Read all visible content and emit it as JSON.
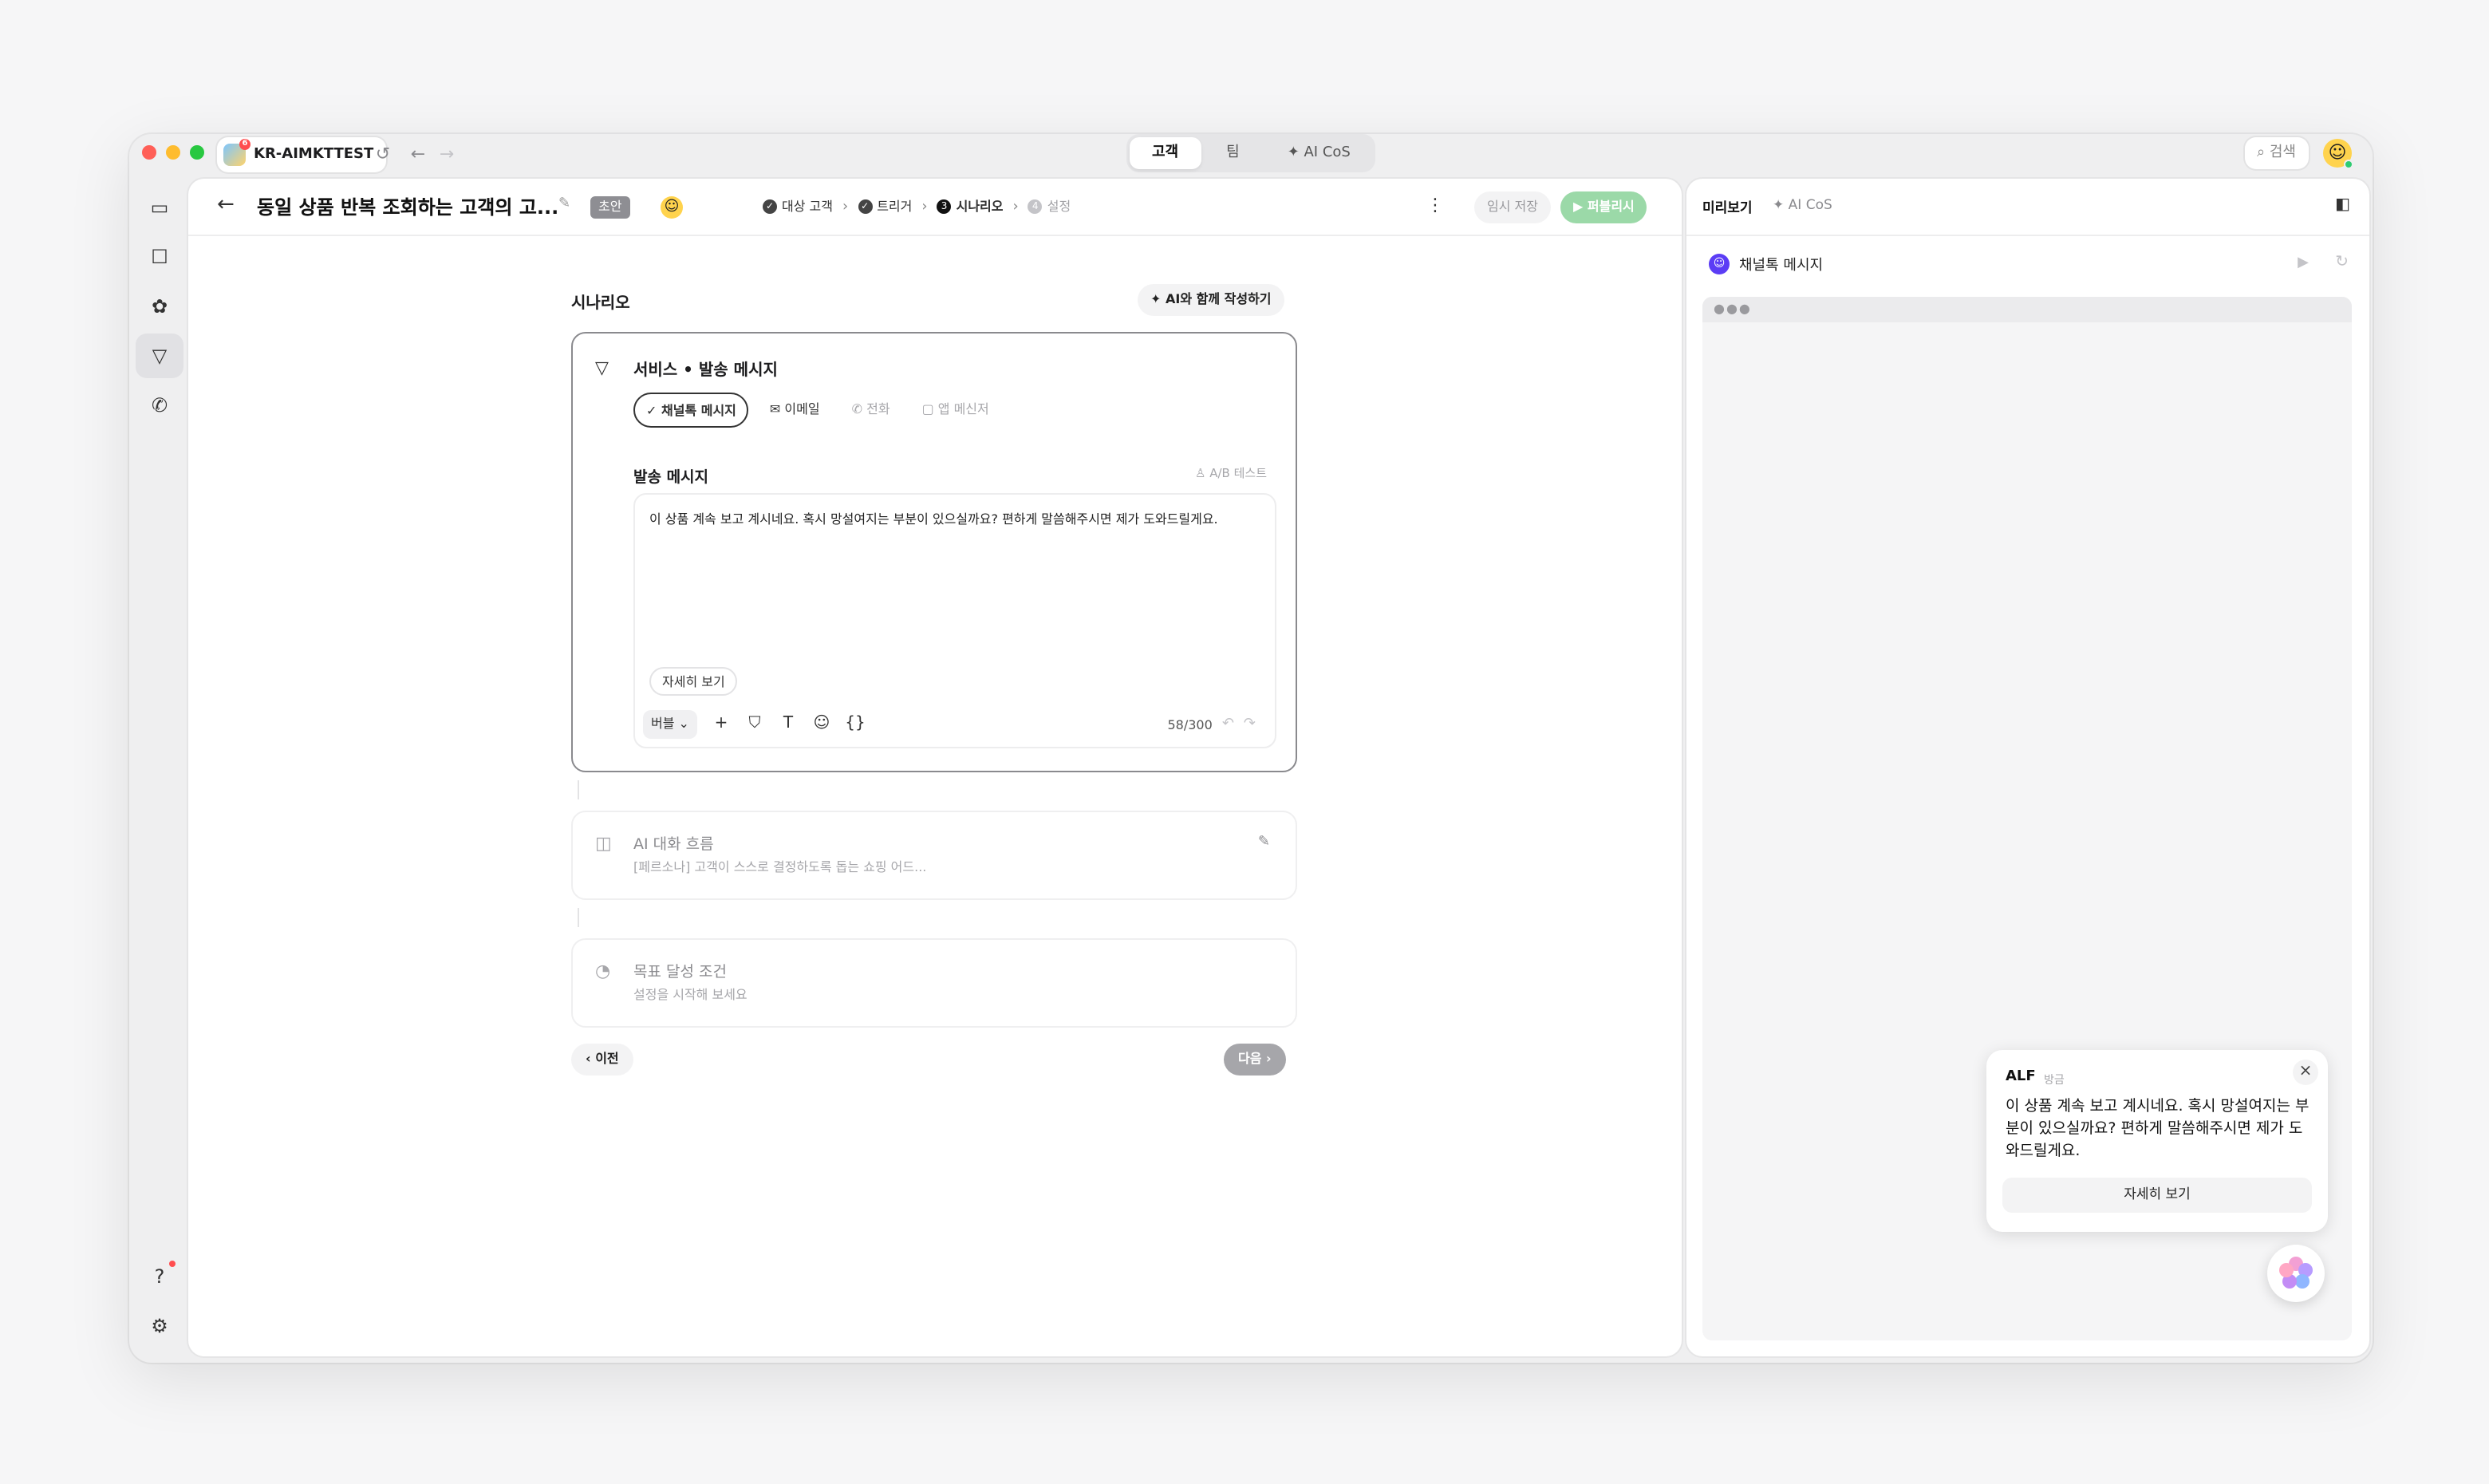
{
  "titlebar": {
    "workspace_name": "KR-AIMKTTEST",
    "workspace_badge": "6",
    "tabs": [
      {
        "label": "고객",
        "active": true
      },
      {
        "label": "팀",
        "active": false
      },
      {
        "label": "✦ AI CoS",
        "active": false
      }
    ],
    "search_label": "검색"
  },
  "header": {
    "title": "동일 상품 반복 조회하는 고객의 고...",
    "status_badge": "초안",
    "steps": [
      {
        "label": "대상 고객",
        "state": "done"
      },
      {
        "label": "트리거",
        "state": "done"
      },
      {
        "label": "시나리오",
        "state": "current",
        "number": "3"
      },
      {
        "label": "설정",
        "state": "upcoming",
        "number": "4"
      }
    ],
    "temp_save_label": "임시 저장",
    "publish_label": "퍼블리시"
  },
  "scenario": {
    "section_label": "시나리오",
    "ai_write_label": "AI와 함께 작성하기",
    "service_title": "서비스 • 발송 메시지",
    "channels": [
      {
        "label": "채널톡 메시지",
        "selected": true,
        "icon": "check-icon"
      },
      {
        "label": "이메일",
        "selected": false,
        "icon": "mail-icon"
      },
      {
        "label": "전화",
        "selected": false,
        "icon": "phone-icon"
      },
      {
        "label": "앱 메신저",
        "selected": false,
        "icon": "app-icon"
      }
    ],
    "message_label": "발송 메시지",
    "ab_test_label": "A/B 테스트",
    "message_text": "이 상품 계속 보고 계시네요. 혹시 망설여지는 부분이 있으실까요? 편하게 말씀해주시면 제가 도와드릴게요.",
    "detail_button_label": "자세히 보기",
    "bubble_select_label": "버블",
    "char_count": "58/300"
  },
  "ai_flow": {
    "title": "AI 대화 흐름",
    "description": "[페르소나] 고객이 스스로 결정하도록 돕는 쇼핑 어드..."
  },
  "goal": {
    "title": "목표 달성 조건",
    "description": "설정을 시작해 보세요"
  },
  "nav_buttons": {
    "prev_label": "이전",
    "next_label": "다음"
  },
  "preview": {
    "tab_preview": "미리보기",
    "tab_ai_cos": "✦ AI CoS",
    "channel_label": "채널톡 메시지",
    "popup_sender": "ALF",
    "popup_time": "방금",
    "popup_text": "이 상품 계속 보고 계시네요. 혹시 망설여지는 부분이 있으실까요? 편하게 말씀해주시면 제가 도와드릴게요.",
    "popup_button": "자세히 보기"
  },
  "colors": {
    "publish_bg": "#9bd9a8",
    "next_bg": "#a6a6aa",
    "channel_icon": "#5b3df5"
  }
}
